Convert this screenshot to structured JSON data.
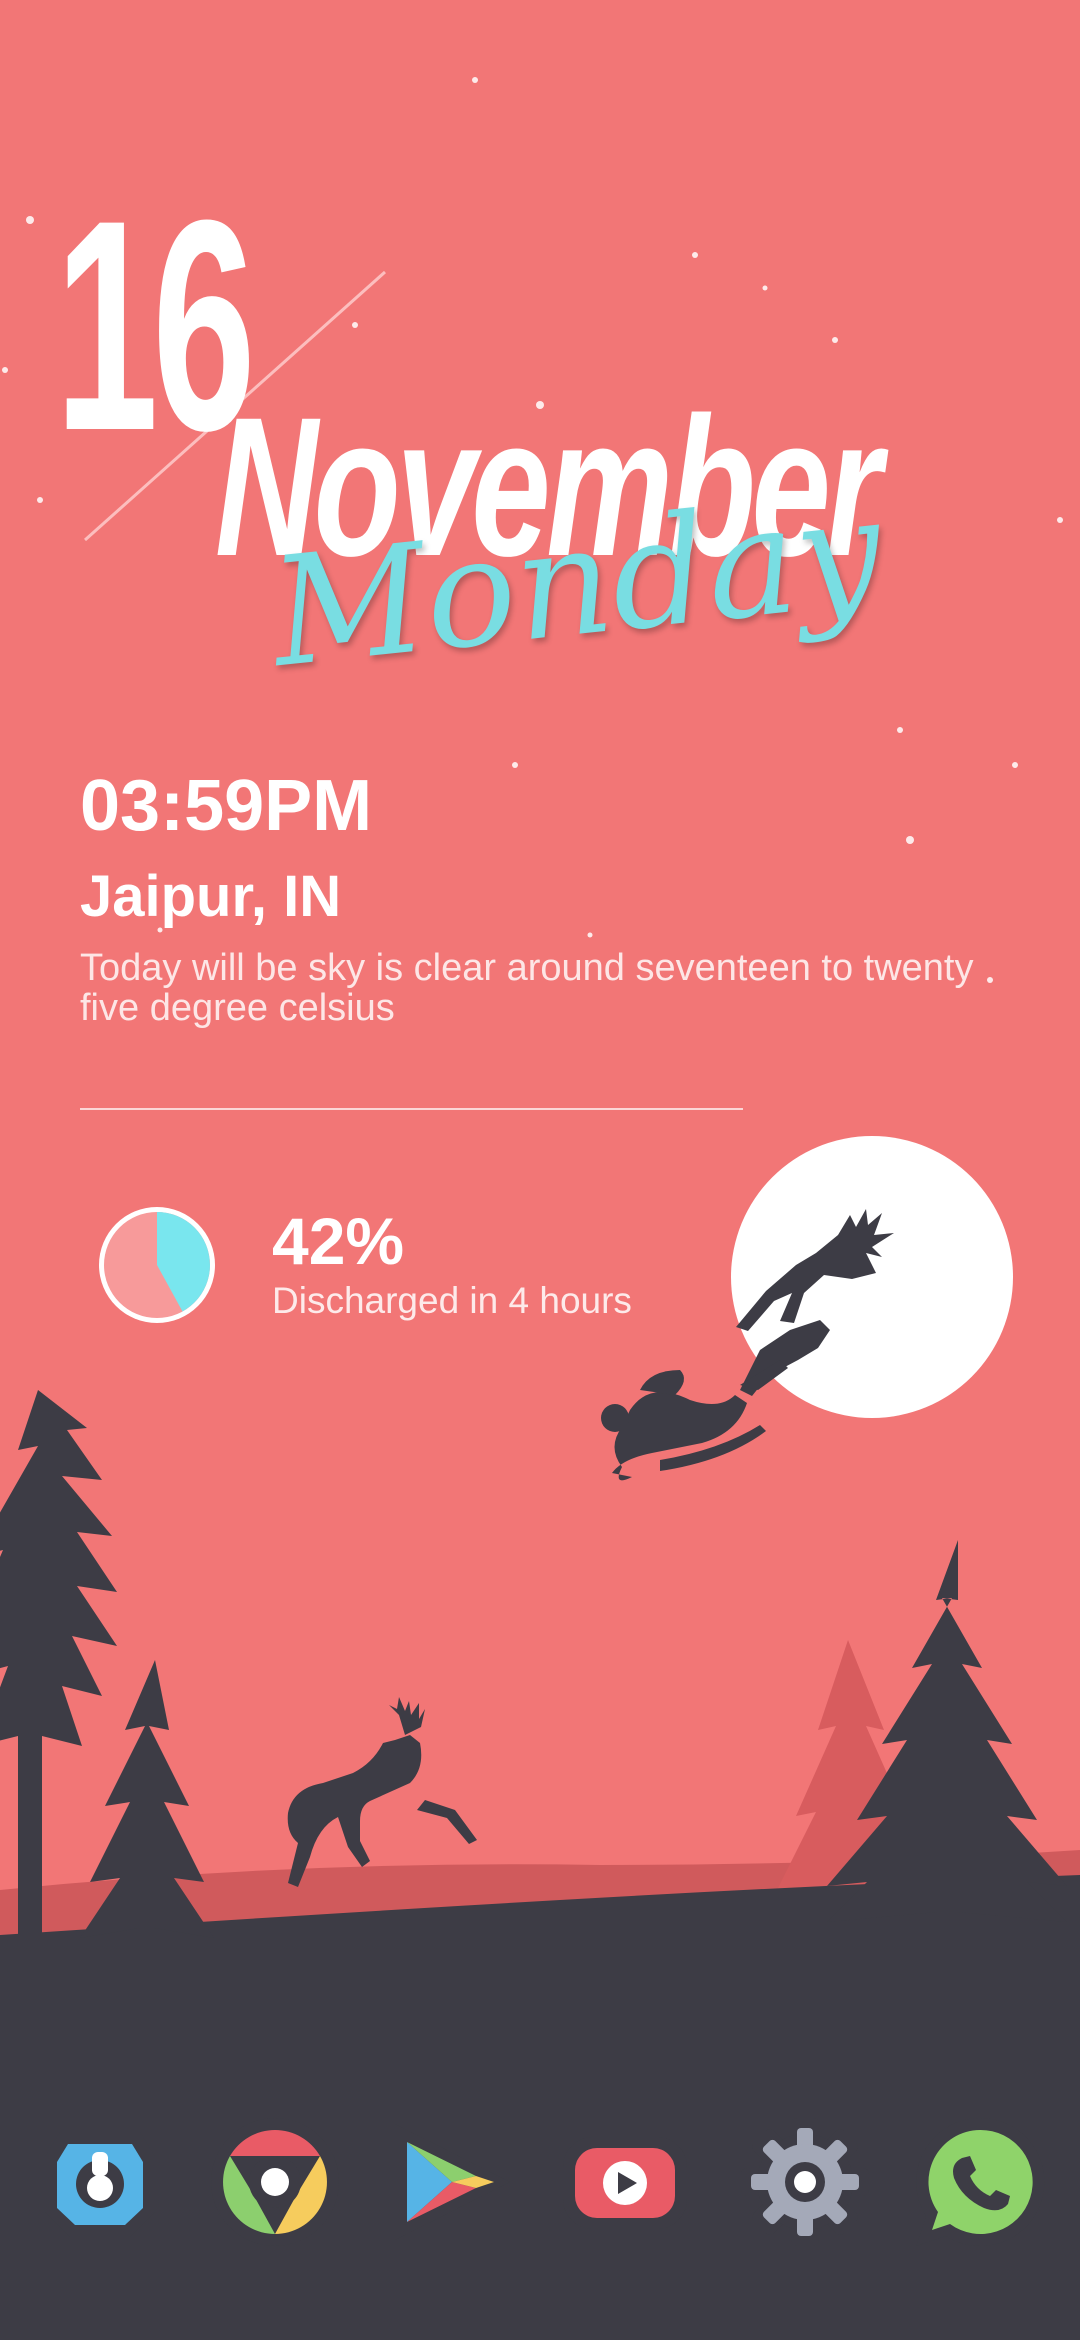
{
  "date": {
    "day": "16",
    "month": "November",
    "weekday": "Monday"
  },
  "clock": {
    "time": "03:59PM"
  },
  "weather": {
    "location": "Jaipur, IN",
    "forecast": "Today will be sky is clear around seventeen to twenty five degree celsius"
  },
  "battery": {
    "level_percent": 42,
    "percent_label": "42%",
    "status": "Discharged in 4 hours"
  },
  "colors": {
    "background": "#f27676",
    "ground": "#3d3c45",
    "accent_cyan": "#79e6ee",
    "moon": "#ffffff"
  },
  "dock": {
    "apps": [
      {
        "icon": "launcher-icon"
      },
      {
        "icon": "chrome-icon"
      },
      {
        "icon": "play-store-icon"
      },
      {
        "icon": "youtube-icon"
      },
      {
        "icon": "settings-icon"
      },
      {
        "icon": "whatsapp-icon"
      }
    ]
  }
}
